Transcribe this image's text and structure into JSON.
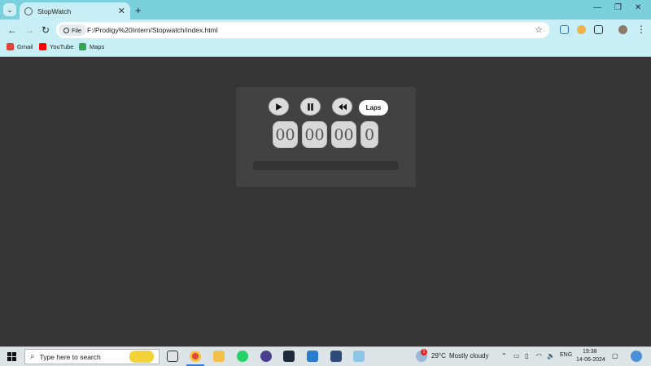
{
  "browser": {
    "tab_title": "StopWatch",
    "new_tab": "+",
    "close_tab": "✕",
    "chip_label": "File",
    "url": "F:/Prodigy%20Intern/Stopwatch/index.html",
    "win_minimize": "—",
    "win_restore": "❐",
    "win_close": "✕"
  },
  "bookmarks": [
    {
      "label": "Gmail"
    },
    {
      "label": "YouTube"
    },
    {
      "label": "Maps"
    }
  ],
  "stopwatch": {
    "laps_label": "Laps",
    "hours": "00",
    "minutes": "00",
    "seconds": "00",
    "milliseconds": "0"
  },
  "taskbar": {
    "search_placeholder": "Type here to search",
    "weather_temp": "29°C",
    "weather_text": "Mostly cloudy",
    "language": "ENG",
    "time": "19:38",
    "date": "14-06-2024",
    "notification_badge": "1"
  },
  "colors": {
    "page_bg": "#353535",
    "panel_bg": "#424242",
    "chrome_accent": "#7ad0dc"
  }
}
